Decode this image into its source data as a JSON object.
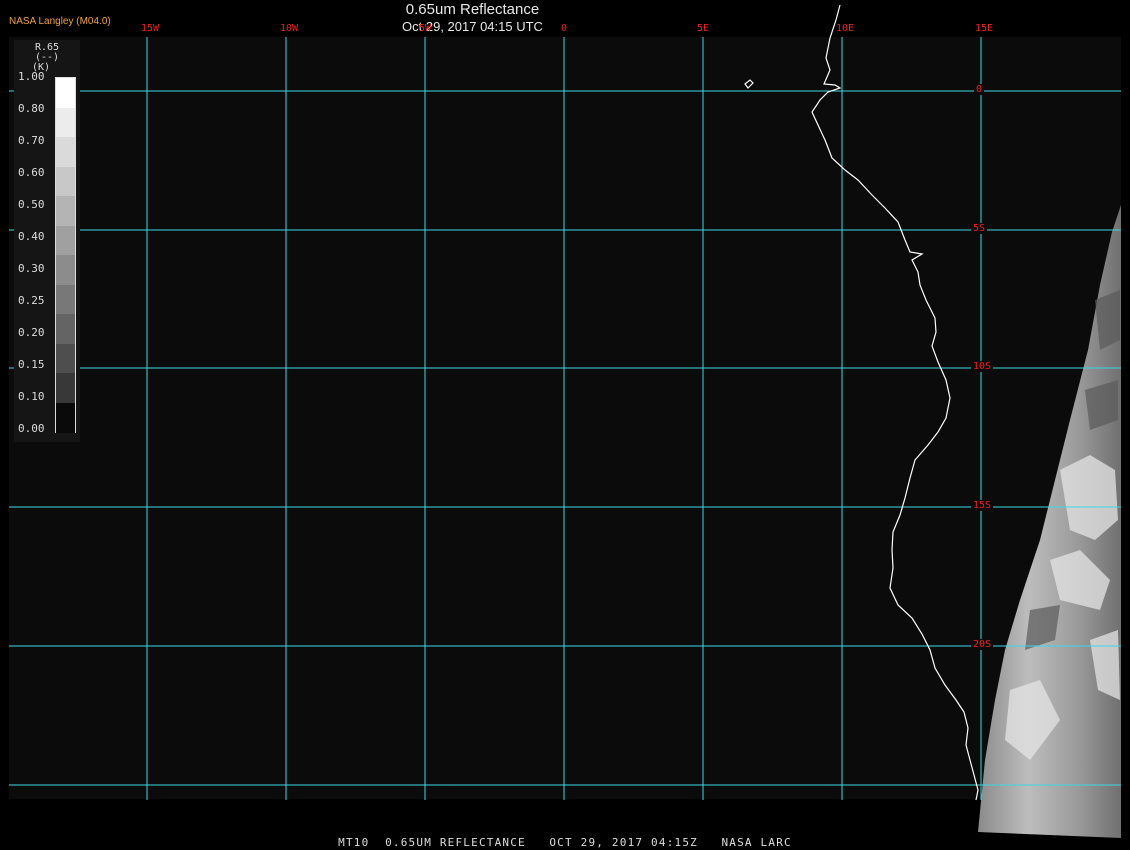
{
  "header": {
    "credit": "NASA Langley (M04.0)",
    "title": "0.65um Reflectance",
    "subtitle": "Oct 29, 2017 04:15 UTC"
  },
  "footer": {
    "caption": "MT10  0.65UM REFLECTANCE   OCT 29, 2017 04:15Z   NASA LARC"
  },
  "colorbar": {
    "title": "R.65",
    "units": "(--)",
    "unit_prefix": "(K)",
    "ticks": [
      "1.00",
      "0.80",
      "0.70",
      "0.60",
      "0.50",
      "0.40",
      "0.30",
      "0.25",
      "0.20",
      "0.15",
      "0.10",
      "0.00"
    ],
    "swatches": [
      "#ffffff",
      "#ececec",
      "#dadada",
      "#c8c8c8",
      "#b4b4b4",
      "#a0a0a0",
      "#8c8c8c",
      "#787878",
      "#646464",
      "#4e4e4e",
      "#383838",
      "#0a0a0a"
    ]
  },
  "map": {
    "background": "#0b0b0b",
    "grid_color": "#3cd8e6",
    "coast_color": "#ffffff",
    "label_color": "#ee2020",
    "longitude_labels": [
      "15W",
      "10W",
      "5W",
      "0",
      "5E",
      "10E",
      "15E"
    ],
    "latitude_labels": [
      "0",
      "5S",
      "10S",
      "15S",
      "20S"
    ]
  }
}
